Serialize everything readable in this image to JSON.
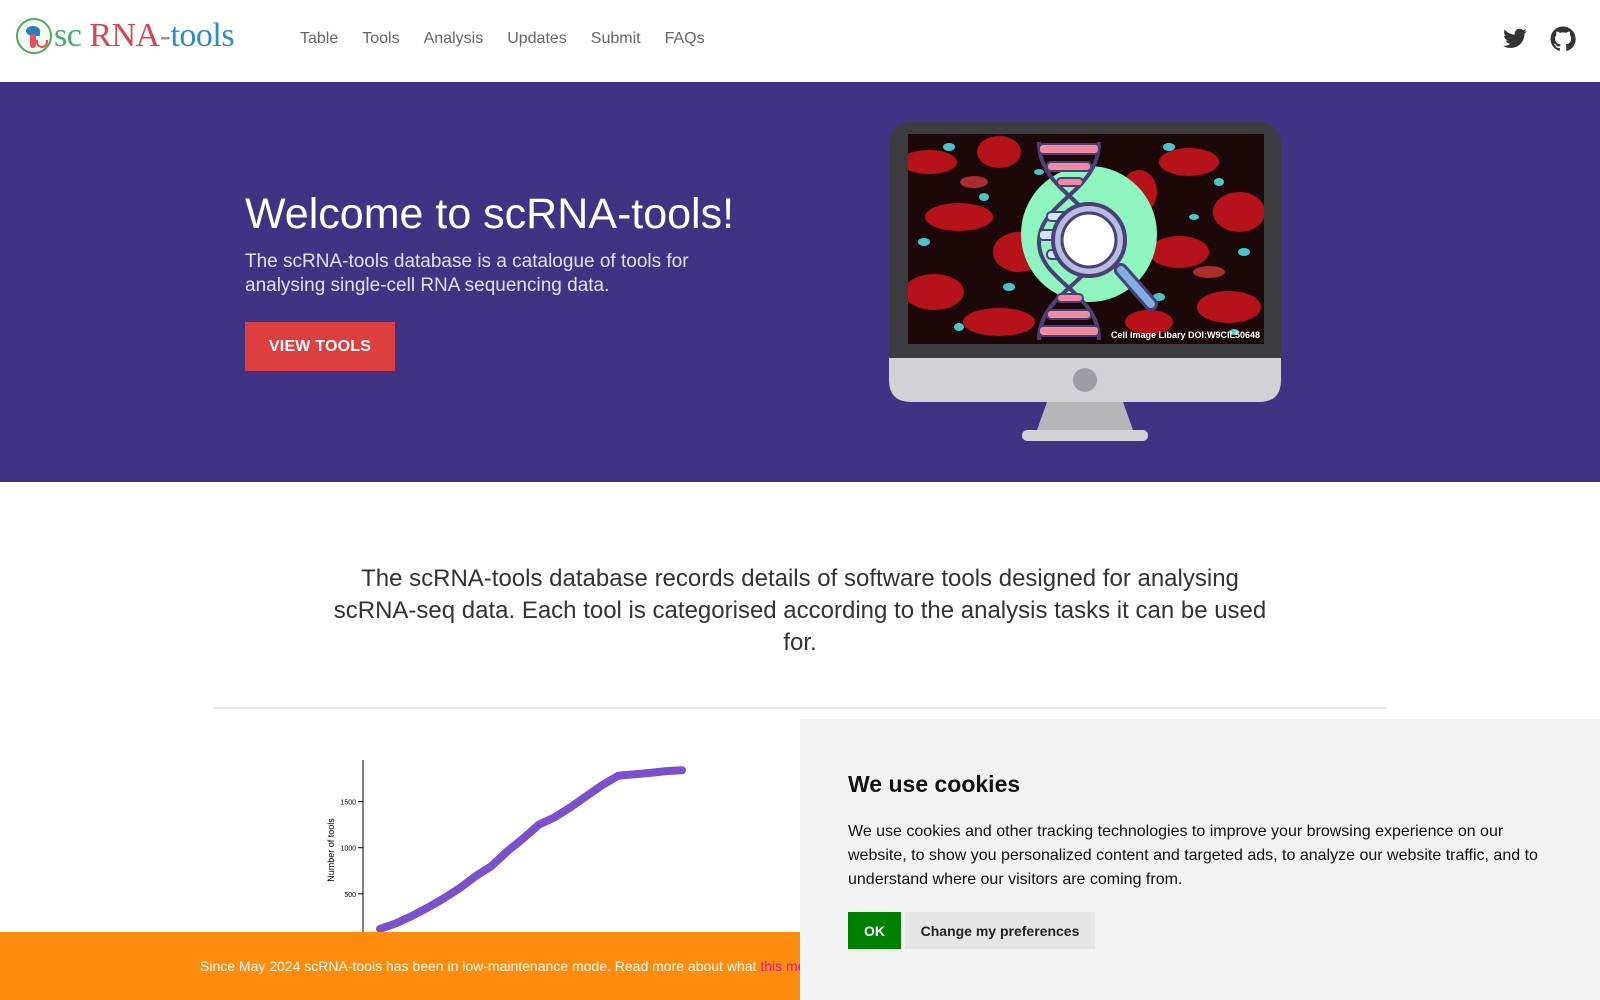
{
  "brand": {
    "sc": "sc",
    "rna": " RNA",
    "dash": "-",
    "tools": "tools"
  },
  "nav": {
    "items": [
      {
        "label": "Table"
      },
      {
        "label": "Tools"
      },
      {
        "label": "Analysis"
      },
      {
        "label": "Updates"
      },
      {
        "label": "Submit"
      },
      {
        "label": "FAQs"
      }
    ],
    "icons": [
      "twitter-icon",
      "github-icon"
    ]
  },
  "hero": {
    "title": "Welcome to scRNA-tools!",
    "subtitle": "The scRNA-tools database is a catalogue of tools for analysing single-cell RNA sequencing data.",
    "button": "VIEW TOOLS",
    "image_caption": "Cell Image Libary DOI:W9CIL50648",
    "colors": {
      "background": "#413384",
      "button": "#dd3f41"
    }
  },
  "intro": {
    "text": "The scRNA-tools database records details of software tools designed for analysing scRNA-seq data. Each tool is categorised according to the analysis tasks it can be used for."
  },
  "chart_data": {
    "type": "line",
    "ylabel": "Number of tools",
    "yticks": [
      500,
      1000,
      1500
    ],
    "ylim": [
      0,
      1950
    ],
    "series": [
      {
        "color": "#7b50cc",
        "values": [
          120,
          180,
          260,
          350,
          450,
          560,
          690,
          800,
          960,
          1100,
          1250,
          1330,
          1440,
          1560,
          1680,
          1780,
          1795,
          1810,
          1830,
          1840
        ]
      }
    ]
  },
  "banner": {
    "text": "Since May 2024 scRNA-tools has been in low-maintenance mode. Read more about what ",
    "link": "this me"
  },
  "cookie": {
    "title": "We use cookies",
    "text": "We use cookies and other tracking technologies to improve your browsing experience on our website, to show you personalized content and targeted ads, to analyze our website traffic, and to understand where our visitors are coming from.",
    "ok": "OK",
    "preferences": "Change my preferences"
  }
}
